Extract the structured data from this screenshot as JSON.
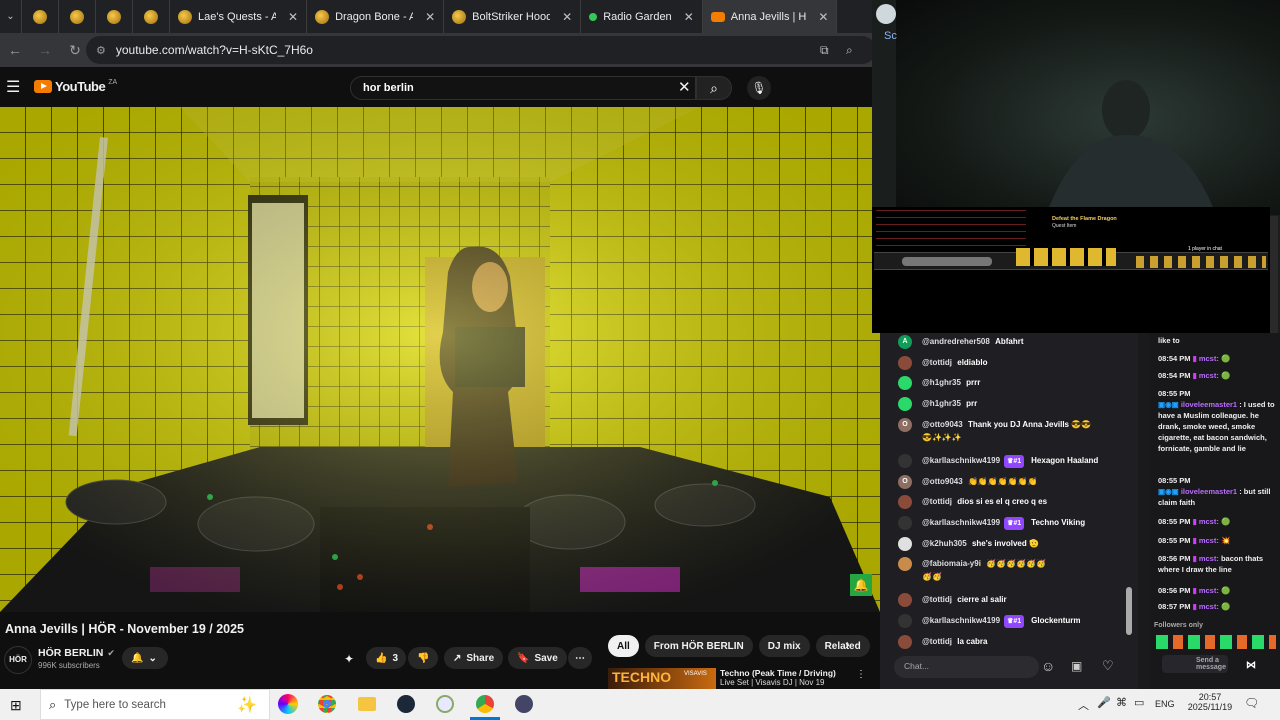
{
  "browser": {
    "tabs": [
      {
        "label": "",
        "icon": "gold-coin-favicon",
        "small": true
      },
      {
        "label": "",
        "icon": "gold-coin-favicon",
        "small": true
      },
      {
        "label": "",
        "icon": "gold-coin-favicon",
        "small": true
      },
      {
        "label": "",
        "icon": "gold-coin-favicon",
        "small": true
      },
      {
        "label": "Lae's Quests - AQ",
        "icon": "gold-coin-favicon"
      },
      {
        "label": "Dragon Bone - AQ",
        "icon": "gold-coin-favicon"
      },
      {
        "label": "BoltStriker Hood -",
        "icon": "gold-coin-favicon"
      },
      {
        "label": "Radio Garden",
        "icon": "green-dot-favicon"
      },
      {
        "label": "Anna Jevills | H",
        "icon": "youtube-favicon",
        "active": true
      }
    ],
    "url": "youtube.com/watch?v=H-sKtC_7H6o"
  },
  "youtube": {
    "logo_text": "YouTube",
    "region": "ZA",
    "search_value": "hor berlin",
    "video_title": "Anna Jevills | HÖR - November 19 / 2025",
    "channel": {
      "name": "HÖR BERLIN",
      "subscribers": "996K subscribers",
      "avatar_text": "HÖR"
    },
    "likes": "3",
    "share_label": "Share",
    "save_label": "Save",
    "chips": [
      "All",
      "From HÖR BERLIN",
      "DJ mix",
      "Related"
    ],
    "rec": {
      "thumb_text": "TECHNO",
      "thumb_sub": "VISAVIS",
      "title": "Techno (Peak Time / Driving)",
      "subtitle": "Live Set | Visavis DJ | Nov 19"
    }
  },
  "chat": {
    "messages": [
      {
        "user": "@andredreher508",
        "text": "Abfahrt",
        "color": "#0f9d58",
        "initial": "A"
      },
      {
        "user": "@tottidj",
        "text": "eldiablo",
        "color": "#8a4b3a",
        "initial": ""
      },
      {
        "user": "@h1ghr35",
        "text": "prrr",
        "color": "#2bd86a",
        "initial": ""
      },
      {
        "user": "@h1ghr35",
        "text": "prr",
        "color": "#2bd86a",
        "initial": ""
      },
      {
        "user": "@otto9043",
        "text": "Thank you DJ Anna Jevills 😎😎",
        "text2": "😎✨✨✨",
        "color": "#8d6e63",
        "initial": "O"
      },
      {
        "user": "@karllaschnikw4199",
        "badge": "#1",
        "text": "Hexagon Haaland",
        "color": "#333",
        "initial": ""
      },
      {
        "user": "@otto9043",
        "text": "👏👏👏👏👏👏👏",
        "color": "#8d6e63",
        "initial": "O"
      },
      {
        "user": "@tottidj",
        "text": "dios si es el q creo q es",
        "color": "#8a4b3a",
        "initial": ""
      },
      {
        "user": "@karllaschnikw4199",
        "badge": "#1",
        "text": "Techno Viking",
        "color": "#333",
        "initial": ""
      },
      {
        "user": "@k2huh305",
        "text": "she's involved 🫡",
        "color": "#e0e0e0",
        "initial": ""
      },
      {
        "user": "@fabiomaia-y9i",
        "text": "🥳🥳🥳🥳🥳🥳",
        "text2": "🥳🥳",
        "color": "#c98b4b",
        "initial": ""
      },
      {
        "user": "@tottidj",
        "text": "cierre al salir",
        "color": "#8a4b3a",
        "initial": ""
      },
      {
        "user": "@karllaschnikw4199",
        "badge": "#1",
        "text": "Glockenturm",
        "color": "#333",
        "initial": ""
      },
      {
        "user": "@tottidj",
        "text": "la cabra",
        "color": "#8a4b3a",
        "initial": ""
      }
    ],
    "placeholder": "Chat..."
  },
  "twitch_side": {
    "lines": [
      {
        "time": "",
        "nick": "",
        "text": "like to"
      },
      {
        "time": "08:54 PM",
        "nick": "mcst:",
        "text": "🟢"
      },
      {
        "time": "08:54 PM",
        "nick": "mcst:",
        "text": "🟢"
      },
      {
        "time": "08:55 PM",
        "nick": "",
        "text": ""
      },
      {
        "time": "",
        "nick": "iloveleemaster1",
        "text": ": I used to have a Muslim colleague. he drank, smoke weed, smoke cigarette, eat bacon sandwich, fornicate, gamble and lie"
      },
      {
        "time": "08:55 PM",
        "nick": "",
        "text": ""
      },
      {
        "time": "",
        "nick": "iloveleemaster1",
        "text": ": but still claim faith"
      },
      {
        "time": "08:55 PM",
        "nick": "mcst:",
        "text": "🟢"
      },
      {
        "time": "08:55 PM",
        "nick": "mcst:",
        "text": "💥"
      },
      {
        "time": "08:56 PM",
        "nick": "mcst:",
        "text": "bacon thats where I draw the line"
      },
      {
        "time": "08:56 PM",
        "nick": "mcst:",
        "text": "🟢"
      },
      {
        "time": "08:57 PM",
        "nick": "mcst:",
        "text": "🟢"
      }
    ],
    "followers_only": "Followers only",
    "send_label": "Send a message"
  },
  "game": {
    "title": "Defeat the Flame Dragon",
    "sub": "Quest Item",
    "player_count": "1 player in chat"
  },
  "taskbar": {
    "search_placeholder": "Type here to search",
    "lang": "ENG",
    "time": "20:57",
    "date": "2025/11/19"
  }
}
